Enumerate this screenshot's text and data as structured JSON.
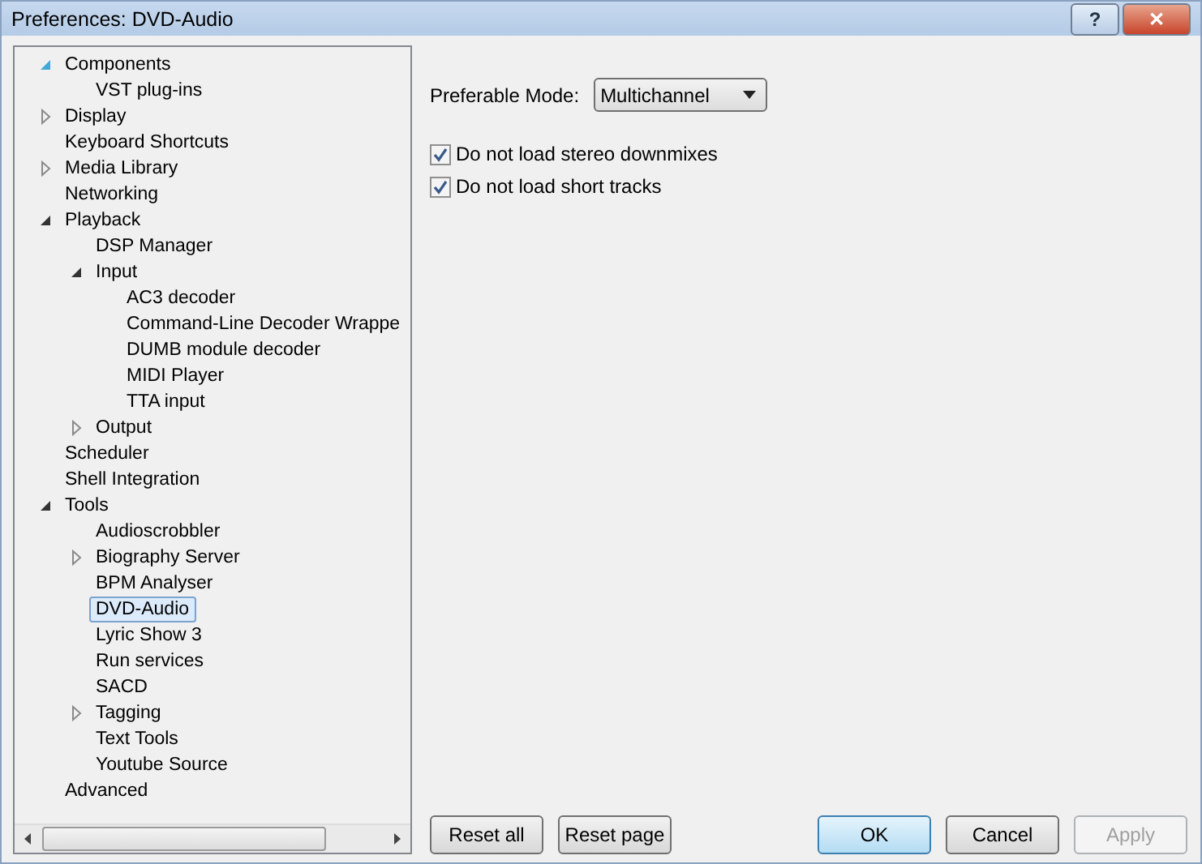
{
  "window": {
    "title": "Preferences: DVD-Audio",
    "help_button": "?",
    "close_button": "✕"
  },
  "tree": [
    {
      "label": "Components",
      "expanded": true,
      "selected": false,
      "children": [
        {
          "label": "VST plug-ins",
          "selected": false
        }
      ]
    },
    {
      "label": "Display",
      "expanded": false,
      "selected": false
    },
    {
      "label": "Keyboard Shortcuts",
      "selected": false
    },
    {
      "label": "Media Library",
      "expanded": false,
      "selected": false
    },
    {
      "label": "Networking",
      "selected": false
    },
    {
      "label": "Playback",
      "expanded": true,
      "selected": false,
      "children": [
        {
          "label": "DSP Manager",
          "selected": false
        },
        {
          "label": "Input",
          "expanded": true,
          "selected": false,
          "children": [
            {
              "label": "AC3 decoder",
              "selected": false
            },
            {
              "label": "Command-Line Decoder Wrappe",
              "selected": false
            },
            {
              "label": "DUMB module decoder",
              "selected": false
            },
            {
              "label": "MIDI Player",
              "selected": false
            },
            {
              "label": "TTA input",
              "selected": false
            }
          ]
        },
        {
          "label": "Output",
          "expanded": false,
          "selected": false
        }
      ]
    },
    {
      "label": "Scheduler",
      "selected": false
    },
    {
      "label": "Shell Integration",
      "selected": false
    },
    {
      "label": "Tools",
      "expanded": true,
      "selected": false,
      "children": [
        {
          "label": "Audioscrobbler",
          "selected": false
        },
        {
          "label": "Biography Server",
          "expanded": false,
          "selected": false
        },
        {
          "label": "BPM Analyser",
          "selected": false
        },
        {
          "label": "DVD-Audio",
          "selected": true
        },
        {
          "label": "Lyric Show 3",
          "selected": false
        },
        {
          "label": "Run services",
          "selected": false
        },
        {
          "label": "SACD",
          "selected": false
        },
        {
          "label": "Tagging",
          "expanded": false,
          "selected": false
        },
        {
          "label": "Text Tools",
          "selected": false
        },
        {
          "label": "Youtube Source",
          "selected": false
        }
      ]
    },
    {
      "label": "Advanced",
      "selected": false
    }
  ],
  "settings": {
    "mode_label": "Preferable Mode:",
    "mode_value": "Multichannel",
    "checkboxes": [
      {
        "label": "Do not load stereo downmixes",
        "checked": true
      },
      {
        "label": "Do not load short tracks",
        "checked": true
      }
    ]
  },
  "buttons": [
    {
      "label": "Reset all",
      "kind": "left",
      "disabled": false,
      "default": false
    },
    {
      "label": "Reset page",
      "kind": "left",
      "disabled": false,
      "default": false
    },
    {
      "label": "OK",
      "kind": "right",
      "disabled": false,
      "default": true
    },
    {
      "label": "Cancel",
      "kind": "right",
      "disabled": false,
      "default": false
    },
    {
      "label": "Apply",
      "kind": "right",
      "disabled": true,
      "default": false
    }
  ]
}
